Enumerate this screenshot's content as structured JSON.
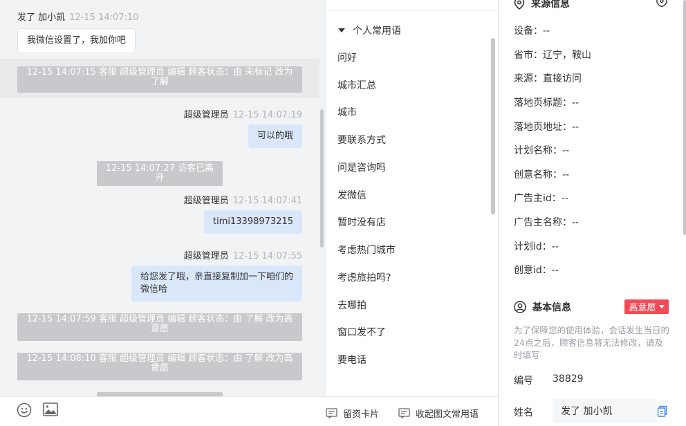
{
  "chat": {
    "messages": [
      {
        "sender": "发了 加小凯",
        "time": "12-15 14:07:10",
        "text": "我微信设置了，我加你吧"
      },
      {
        "system": "12-15 14:07:15 客服 超级管理员 编辑 顾客状态：由 未标记 改为了解"
      },
      {
        "sender": "超级管理员",
        "time": "12-15 14:07:19",
        "text": "可以的哦"
      },
      {
        "system": "12-15 14:07:27 访客已离开"
      },
      {
        "sender": "超级管理员",
        "time": "12-15 14:07:41",
        "text": "timi13398973215"
      },
      {
        "sender": "超级管理员",
        "time": "12-15 14:07:55",
        "text": "给您发了哦，亲直接复制加一下咱们的微信哈"
      },
      {
        "system": "12-15 14:07:59 客服 超级管理员 编辑 顾客状态：由 了解 改为高意愿"
      },
      {
        "system": "12-15 14:08:10 客服 超级管理员 编辑 顾客状态：由 了解 改为高意愿"
      }
    ]
  },
  "toolbar": {
    "emoji_icon": "smiley-icon",
    "image_icon": "image-icon",
    "lead_card_label": "留资卡片",
    "collapse_label": "收起图文常用语"
  },
  "phrases": {
    "group_label": "个人常用语",
    "items": [
      "问好",
      "城市汇总",
      "城市",
      "要联系方式",
      "问是咨询吗",
      "发微信",
      "暂时没有店",
      "考虑热门城市",
      "考虑旅拍吗?",
      "去哪拍",
      "窗口发不了",
      "要电话"
    ]
  },
  "info": {
    "source_title": "来源信息",
    "source_fields": [
      "设备：--",
      "省市：辽宁，鞍山",
      "来源：直接访问",
      "落地页标题：--",
      "落地页地址：--",
      "计划名称：--",
      "创意名称：--",
      "广告主id：--",
      "广告主名称：--",
      "计划id：--",
      "创意id：--"
    ],
    "basic_title": "基本信息",
    "intent_badge": "高意愿",
    "notice": "为了保障您的使用体验，会话发生当日的24点之后，顾客信息将无法修改，请及时填写",
    "id_label": "编号",
    "id_value": "38829",
    "name_label": "姓名",
    "name_value": "发了 加小凯"
  },
  "colors": {
    "accent_blue": "#3d7ff5",
    "bubble_blue": "#dae7fb",
    "badge_red": "#f04b57",
    "system_gray": "#c8c9cc"
  }
}
